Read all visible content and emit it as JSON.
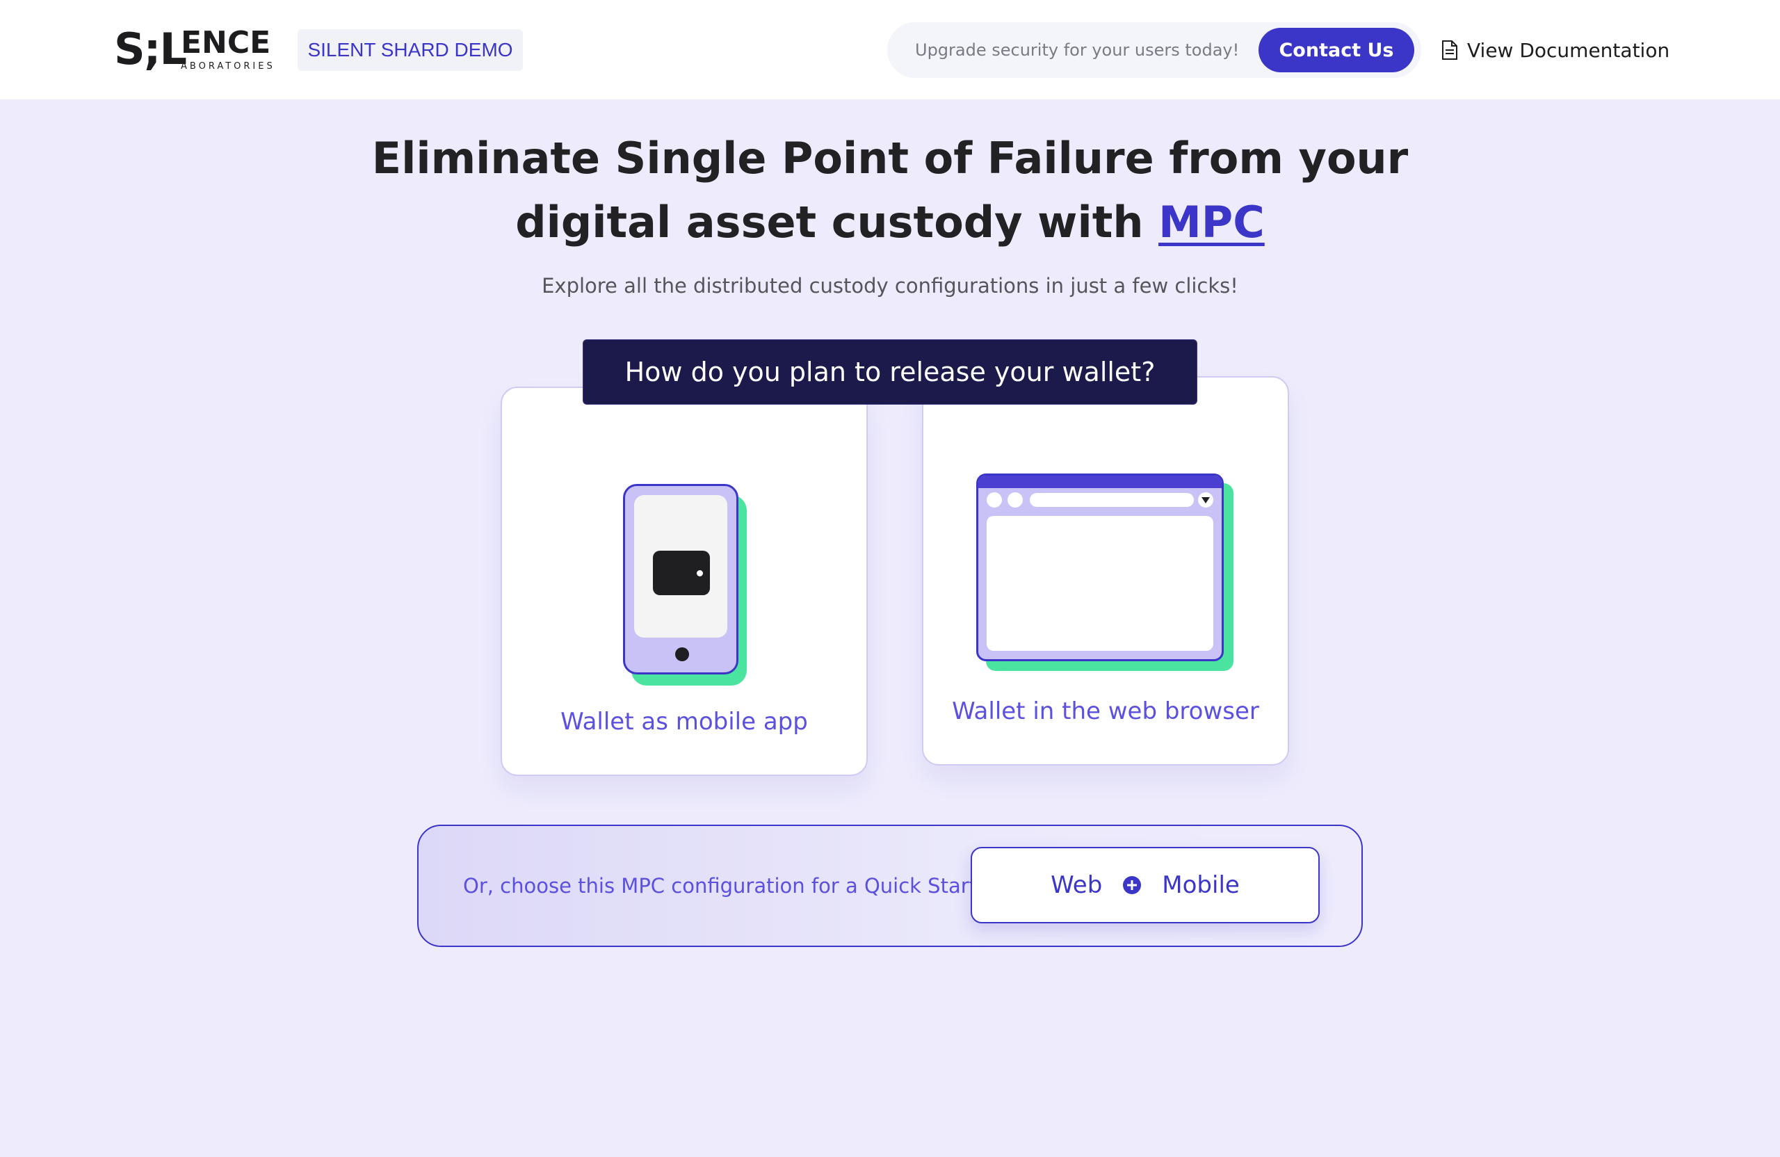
{
  "header": {
    "logo": {
      "mark": "S;L",
      "wordmark": "ENCE",
      "subtext": "ABORATORIES"
    },
    "demo_badge": "SILENT SHARD DEMO",
    "upgrade_text": "Upgrade security for your users today!",
    "contact_label": "Contact Us",
    "docs_label": "View Documentation",
    "docs_icon": "document-icon"
  },
  "hero": {
    "title_part1": "Eliminate Single Point of Failure from your",
    "title_part2": "digital asset custody with",
    "title_link": "MPC",
    "subtitle": "Explore all the distributed custody configurations in just a few clicks!"
  },
  "question": "How do you plan to release your wallet?",
  "options": {
    "mobile": {
      "label": "Wallet as mobile app",
      "icon": "mobile-wallet-icon"
    },
    "web": {
      "label": "Wallet in the web browser",
      "icon": "browser-wallet-icon"
    }
  },
  "quickstart": {
    "text": "Or, choose this MPC configuration for a Quick Start!",
    "option_web": "Web",
    "option_mobile": "Mobile",
    "joiner_icon": "plus-circle-icon"
  },
  "colors": {
    "accent": "#3b35c8",
    "accent_light": "#5b50e0",
    "green": "#4be3a0",
    "banner": "#1c1a4a",
    "page_bg": "#eeecfc"
  }
}
